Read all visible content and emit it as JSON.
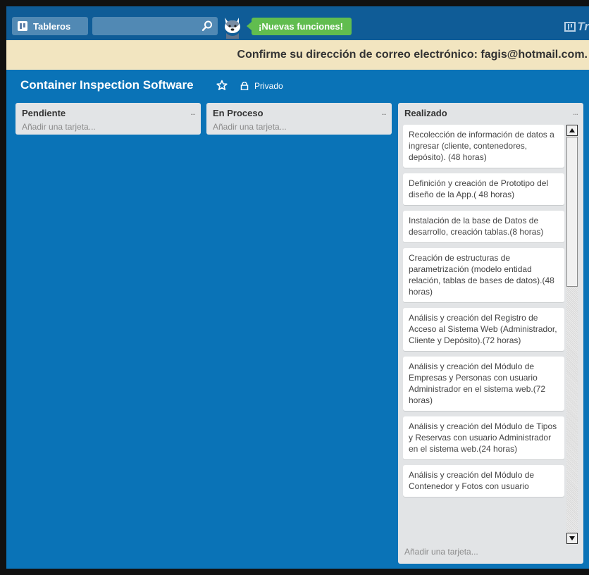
{
  "header": {
    "boards_label": "Tableros",
    "search_value": "",
    "news_label": "¡Nuevas funciones!",
    "logo_text": "Tr"
  },
  "banner": {
    "text": "Confirme su dirección de correo electrónico: fagis@hotmail.com."
  },
  "board": {
    "title": "Container Inspection Software",
    "privacy": "Privado"
  },
  "lists": [
    {
      "title": "Pendiente",
      "menu": "...",
      "add_card": "Añadir una tarjeta...",
      "cards": []
    },
    {
      "title": "En Proceso",
      "menu": "...",
      "add_card": "Añadir una tarjeta...",
      "cards": []
    },
    {
      "title": "Realizado",
      "menu": "...",
      "add_card": "Añadir una tarjeta...",
      "cards": [
        "Recolección de información de datos a ingresar (cliente, contenedores, depósito). (48 horas)",
        "Definición y creación de Prototipo del diseño de la App.( 48 horas)",
        "Instalación de la base de Datos de desarrollo, creación tablas.(8 horas)",
        "Creación de estructuras de parametrización (modelo entidad relación, tablas de bases de datos).(48 horas)",
        "Análisis y creación del Registro de Acceso al Sistema Web (Administrador, Cliente y Depósito).(72 horas)",
        "Análisis y creación del Módulo de Empresas y Personas con usuario Administrador en el sistema web.(72 horas)",
        "Análisis y creación del Módulo de Tipos y Reservas con usuario Administrador en el sistema web.(24 horas)",
        "Análisis y creación del Módulo de Contenedor y Fotos con usuario"
      ]
    }
  ],
  "colors": {
    "board_bg": "#0a73b7",
    "header_bg": "#0f5c97",
    "banner_bg": "#f2e5c0",
    "news_green": "#61bd4f",
    "list_bg": "#e2e4e6"
  }
}
